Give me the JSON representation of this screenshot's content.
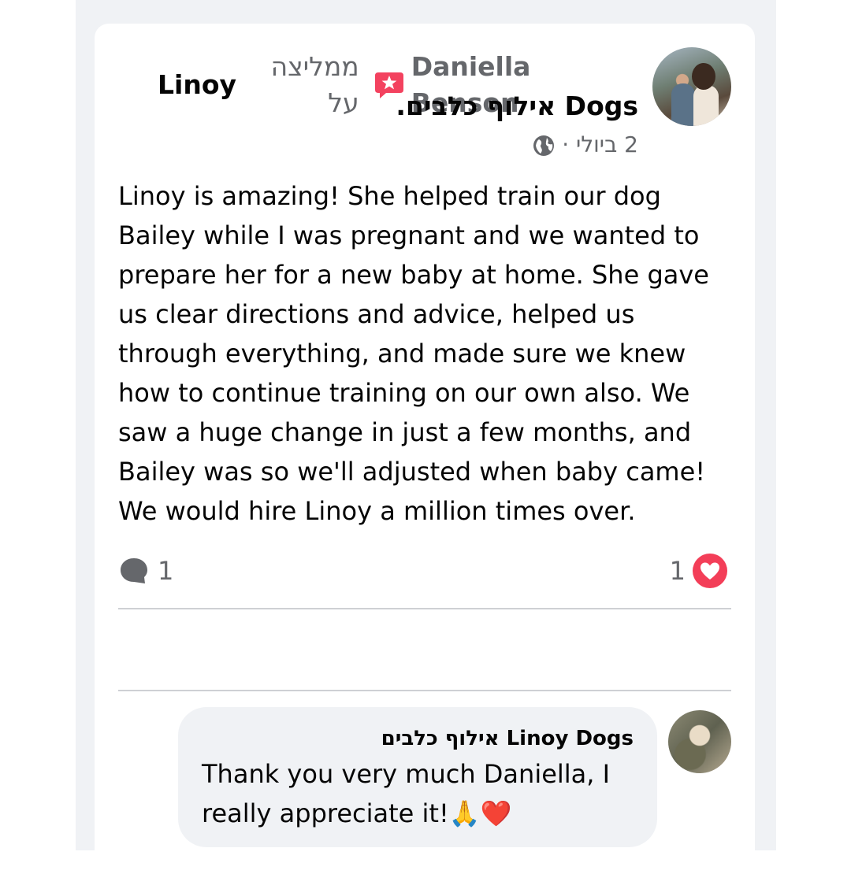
{
  "post": {
    "author_name": "Daniella Benson",
    "recommends_text": "ממליצה על",
    "target_page_first": "Linoy",
    "target_page_second": "Dogs אילוף כלבים.",
    "date": "2 ביולי ·",
    "body_lines": [
      "Linoy is amazing! She helped train our dog",
      "Bailey while I was pregnant and we wanted to",
      "prepare her for a new baby at home. She gave",
      "us clear directions and advice, helped us",
      "through everything, and made sure we knew",
      "how to continue training on our own also. We",
      "saw a huge change in just a few months, and",
      "Bailey was so we'll adjusted when baby came!",
      "We would hire Linoy a million times over."
    ],
    "comment_count": "1",
    "reaction_count": "1"
  },
  "reply": {
    "author_name": "Linoy Dogs אילוף כלבים",
    "text_lines": [
      "Thank you very much Daniella, I",
      "really appreciate it!🙏❤️"
    ]
  },
  "colors": {
    "recommend_icon": "#f3425f",
    "love_reaction": "#f33e58",
    "secondary_text": "#65676b"
  }
}
